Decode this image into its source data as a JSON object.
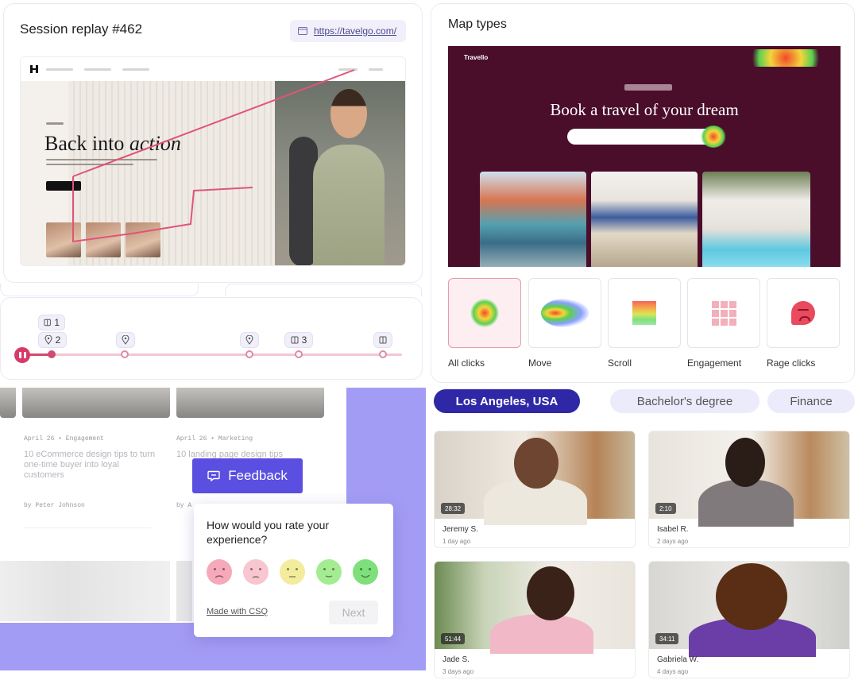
{
  "session": {
    "title": "Session replay #462",
    "url": "https://tavelgo.com/",
    "hero_plain": "Back into ",
    "hero_italic": "action"
  },
  "timeline": {
    "chip_1": "1",
    "chip_2": "2",
    "chip_3": "3"
  },
  "maptypes": {
    "title": "Map types",
    "site_logo": "Travello",
    "hero": "Book a travel of your dream",
    "tiles": [
      {
        "label": "All clicks",
        "icon": "heatmap-clicks-icon"
      },
      {
        "label": "Move",
        "icon": "heatmap-move-icon"
      },
      {
        "label": "Scroll",
        "icon": "scroll-gradient-icon"
      },
      {
        "label": "Engagement",
        "icon": "grid-engagement-icon"
      },
      {
        "label": "Rage clicks",
        "icon": "angry-face-icon"
      }
    ]
  },
  "blog": {
    "meta_1": "April 26 • Engagement",
    "title_1": "10 eCommerce design tips to turn one-time buyer into loyal customers",
    "author_1": "by Peter Johnson",
    "meta_2": "April 26 • Marketing",
    "title_2": "10 landing page design tips",
    "author_2": "by A"
  },
  "feedback": {
    "button_label": "Feedback",
    "question": "How would you rate your experience?",
    "made_with": "Made with CSQ",
    "next_label": "Next",
    "face_colors": [
      "#f6a9b9",
      "#f8c6cf",
      "#f2ec9c",
      "#a4ec92",
      "#7ee07a"
    ]
  },
  "segments": {
    "active": "Los Angeles, USA",
    "pill_1": "Bachelor's degree",
    "pill_2": "Finance"
  },
  "videos": [
    {
      "name": "Jeremy S.",
      "date": "1 day ago",
      "duration": "28:32"
    },
    {
      "name": "Isabel R.",
      "date": "2 days ago",
      "duration": "2:10"
    },
    {
      "name": "Jade S.",
      "date": "3 days ago",
      "duration": "51:44"
    },
    {
      "name": "Gabriela W.",
      "date": "4 days ago",
      "duration": "34:11"
    }
  ],
  "colors": {
    "accent_pink": "#d83a68",
    "feedback_purple": "#5a4fe0",
    "segment_navy": "#2e28a6",
    "heatmap_site_bg": "#4a0d2a"
  }
}
